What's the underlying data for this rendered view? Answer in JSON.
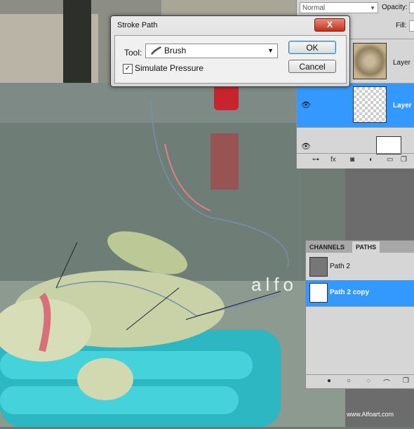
{
  "layers_panel": {
    "blend_mode": "Normal",
    "opacity_label": "Opacity:",
    "fill_label": "Fill:",
    "layers": [
      {
        "name": "Layer",
        "selected": false
      },
      {
        "name": "Layer",
        "selected": true
      }
    ]
  },
  "stroke_dialog": {
    "title": "Stroke Path",
    "close_label": "X",
    "tool_label": "Tool:",
    "tool_value": "Brush",
    "simulate_pressure_label": "Simulate Pressure",
    "simulate_pressure_checked": true,
    "ok_label": "OK",
    "cancel_label": "Cancel"
  },
  "paths_panel": {
    "tabs": [
      "CHANNELS",
      "PATHS"
    ],
    "active_tab": "PATHS",
    "paths": [
      {
        "name": "Path 2",
        "selected": false
      },
      {
        "name": "Path 2 copy",
        "selected": true
      }
    ]
  },
  "canvas_text": "alfo",
  "watermark": "www.Alfoart.com",
  "colors": {
    "selection": "#3399ff",
    "close_button": "#c2321c"
  }
}
